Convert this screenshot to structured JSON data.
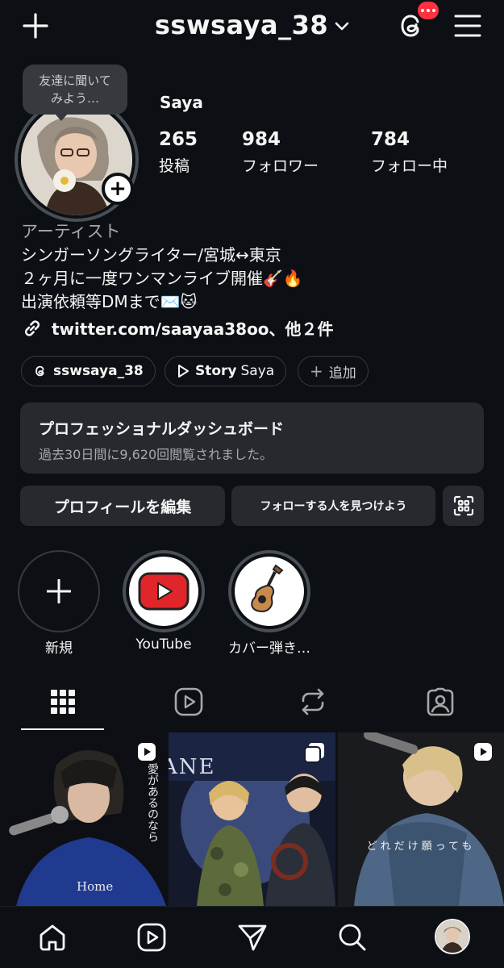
{
  "header": {
    "username": "sswsaya_38",
    "icons": [
      "plus-icon",
      "chevron-down-icon",
      "threads-icon",
      "menu-icon"
    ],
    "badge_color": "#ff3040"
  },
  "profile": {
    "tooltip": [
      "友達に聞いて",
      "みよう…"
    ],
    "display_name": "Saya",
    "stats": [
      {
        "value": "265",
        "label": "投稿"
      },
      {
        "value": "984",
        "label": "フォロワー"
      },
      {
        "value": "784",
        "label": "フォロー中"
      }
    ],
    "category": "アーティスト",
    "bio": [
      "シンガーソングライター/宮城↔東京",
      "２ヶ月に一度ワンマンライブ開催🎸🔥",
      "出演依頼等DMまで✉️🐱"
    ],
    "link": "twitter.com/saayaa38oo、他２件"
  },
  "chips": [
    {
      "label": "sswsaya_38",
      "icon": "threads-icon"
    },
    {
      "label": "Story",
      "sub": "Saya",
      "icon": "play-icon"
    },
    {
      "label": "追加",
      "icon": "plus-icon"
    }
  ],
  "dashboard": {
    "title": "プロフェッショナルダッシュボード",
    "subtitle": "過去30日間に9,620回閲覧されました。"
  },
  "buttons": {
    "edit_profile": "プロフィールを編集",
    "discover": "フォローする人を見つけよう"
  },
  "highlights": [
    {
      "label": "新規"
    },
    {
      "label": "YouTube"
    },
    {
      "label": "カバー弾き…"
    }
  ],
  "tabs": [
    "grid-icon",
    "reels-icon",
    "reposts-icon",
    "tagged-icon"
  ],
  "posts": [
    {
      "overlay": "愛があるのなら",
      "shirt": "Home",
      "type": "reel"
    },
    {
      "overlay": "ANE",
      "type": "carousel"
    },
    {
      "overlay": "どれだけ願っても",
      "type": "reel"
    }
  ],
  "bottom_nav": [
    "home-icon",
    "reels-icon",
    "send-icon",
    "search-icon",
    "profile-avatar"
  ],
  "colors": {
    "background": "#0c1014",
    "surface": "#262a2f",
    "text": "#f5f5f5",
    "muted": "#a8a8a8"
  }
}
